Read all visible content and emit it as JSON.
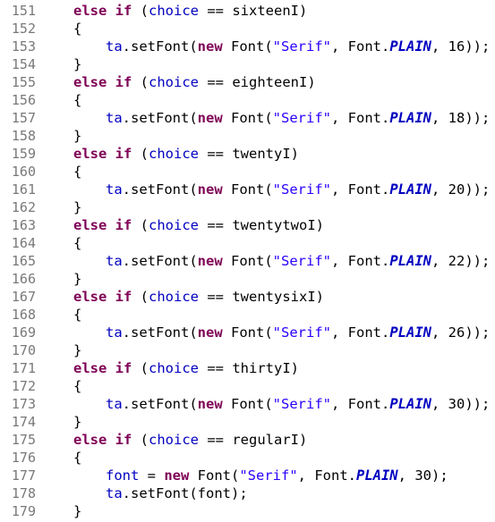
{
  "lines": [
    {
      "n": "151",
      "type": "elseif",
      "indent": 1,
      "kw1": "else",
      "kw2": "if",
      "open": " (",
      "var": "choice",
      "op": " == ",
      "arg": "sixteenI",
      "close": ")"
    },
    {
      "n": "152",
      "type": "brace",
      "indent": 1,
      "text": "{"
    },
    {
      "n": "153",
      "type": "setfont",
      "indent": 2,
      "pre": ".setFont(",
      "ta": "ta",
      "kw": "new",
      "font": " Font(",
      "str": "\"Serif\"",
      "mid": ", Font.",
      "const": "PLAIN",
      "tail": ", 16));"
    },
    {
      "n": "154",
      "type": "brace",
      "indent": 1,
      "text": "}"
    },
    {
      "n": "155",
      "type": "elseif",
      "indent": 1,
      "kw1": "else",
      "kw2": "if",
      "open": " (",
      "var": "choice",
      "op": " == ",
      "arg": "eighteenI",
      "close": ")"
    },
    {
      "n": "156",
      "type": "brace",
      "indent": 1,
      "text": "{"
    },
    {
      "n": "157",
      "type": "setfont",
      "indent": 2,
      "pre": ".setFont(",
      "ta": "ta",
      "kw": "new",
      "font": " Font(",
      "str": "\"Serif\"",
      "mid": ", Font.",
      "const": "PLAIN",
      "tail": ", 18));"
    },
    {
      "n": "158",
      "type": "brace",
      "indent": 1,
      "text": "}"
    },
    {
      "n": "159",
      "type": "elseif",
      "indent": 1,
      "kw1": "else",
      "kw2": "if",
      "open": " (",
      "var": "choice",
      "op": " == ",
      "arg": "twentyI",
      "close": ")"
    },
    {
      "n": "160",
      "type": "brace",
      "indent": 1,
      "text": "{"
    },
    {
      "n": "161",
      "type": "setfont",
      "indent": 2,
      "pre": ".setFont(",
      "ta": "ta",
      "kw": "new",
      "font": " Font(",
      "str": "\"Serif\"",
      "mid": ", Font.",
      "const": "PLAIN",
      "tail": ", 20));"
    },
    {
      "n": "162",
      "type": "brace",
      "indent": 1,
      "text": "}"
    },
    {
      "n": "163",
      "type": "elseif",
      "indent": 1,
      "kw1": "else",
      "kw2": "if",
      "open": " (",
      "var": "choice",
      "op": " == ",
      "arg": "twentytwoI",
      "close": ")"
    },
    {
      "n": "164",
      "type": "brace",
      "indent": 1,
      "text": "{"
    },
    {
      "n": "165",
      "type": "setfont",
      "indent": 2,
      "pre": ".setFont(",
      "ta": "ta",
      "kw": "new",
      "font": " Font(",
      "str": "\"Serif\"",
      "mid": ", Font.",
      "const": "PLAIN",
      "tail": ", 22));"
    },
    {
      "n": "166",
      "type": "brace",
      "indent": 1,
      "text": "}"
    },
    {
      "n": "167",
      "type": "elseif",
      "indent": 1,
      "kw1": "else",
      "kw2": "if",
      "open": " (",
      "var": "choice",
      "op": " == ",
      "arg": "twentysixI",
      "close": ")"
    },
    {
      "n": "168",
      "type": "brace",
      "indent": 1,
      "text": "{"
    },
    {
      "n": "169",
      "type": "setfont",
      "indent": 2,
      "pre": ".setFont(",
      "ta": "ta",
      "kw": "new",
      "font": " Font(",
      "str": "\"Serif\"",
      "mid": ", Font.",
      "const": "PLAIN",
      "tail": ", 26));"
    },
    {
      "n": "170",
      "type": "brace",
      "indent": 1,
      "text": "}"
    },
    {
      "n": "171",
      "type": "elseif",
      "indent": 1,
      "kw1": "else",
      "kw2": "if",
      "open": " (",
      "var": "choice",
      "op": " == ",
      "arg": "thirtyI",
      "close": ")"
    },
    {
      "n": "172",
      "type": "brace",
      "indent": 1,
      "text": "{"
    },
    {
      "n": "173",
      "type": "setfont",
      "indent": 2,
      "pre": ".setFont(",
      "ta": "ta",
      "kw": "new",
      "font": " Font(",
      "str": "\"Serif\"",
      "mid": ", Font.",
      "const": "PLAIN",
      "tail": ", 30));"
    },
    {
      "n": "174",
      "type": "brace",
      "indent": 1,
      "text": "}"
    },
    {
      "n": "175",
      "type": "elseif",
      "indent": 1,
      "kw1": "else",
      "kw2": "if",
      "open": " (",
      "var": "choice",
      "op": " == ",
      "arg": "regularI",
      "close": ")"
    },
    {
      "n": "176",
      "type": "brace",
      "indent": 1,
      "text": "{"
    },
    {
      "n": "177",
      "type": "assign",
      "indent": 2,
      "var": "font",
      "eq": " = ",
      "kw": "new",
      "font": " Font(",
      "str": "\"Serif\"",
      "mid": ", Font.",
      "const": "PLAIN",
      "tail": ", 30);"
    },
    {
      "n": "178",
      "type": "plain",
      "indent": 2,
      "ta": "ta",
      "text": ".setFont(font);"
    },
    {
      "n": "179",
      "type": "brace",
      "indent": 1,
      "text": "}"
    }
  ],
  "colors": {
    "keyword": "#7f0055",
    "field": "#0000c0",
    "string": "#2a00ff",
    "line_number": "#787878",
    "background": "#ffffff"
  }
}
